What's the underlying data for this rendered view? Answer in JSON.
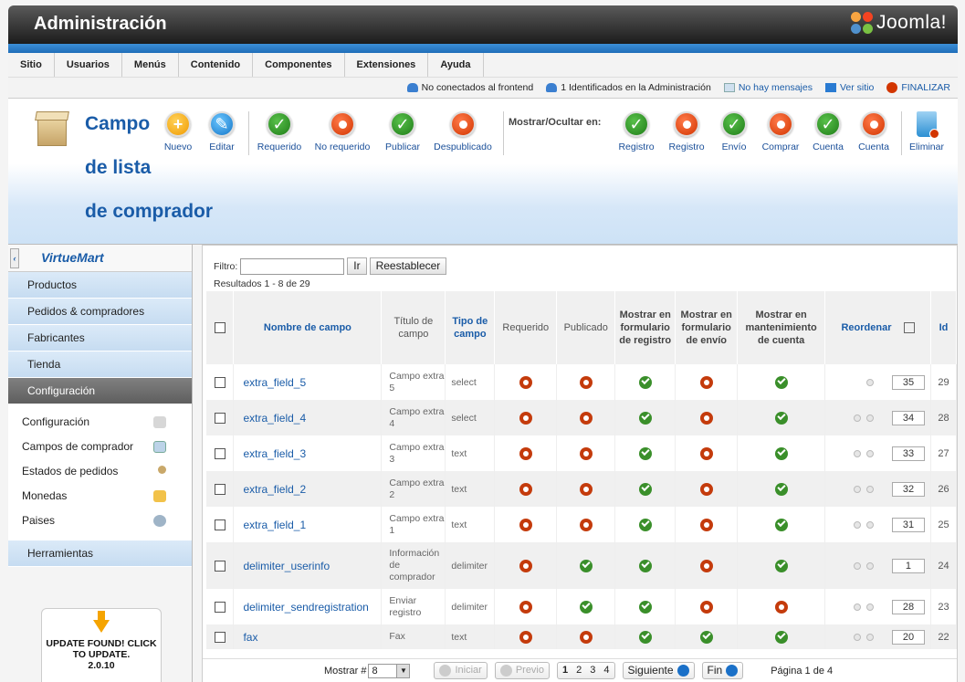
{
  "header": {
    "title": "Administración",
    "brand": "Joomla!"
  },
  "menu": [
    "Sitio",
    "Usuarios",
    "Menús",
    "Contenido",
    "Componentes",
    "Extensiones",
    "Ayuda"
  ],
  "status": {
    "frontend": "No conectados al frontend",
    "admin": "1 Identificados en la Administración",
    "messages": "No hay mensajes",
    "site": "Ver sitio",
    "logout": "FINALIZAR"
  },
  "page": {
    "title_l1": "Campo",
    "title_l2": "de lista",
    "title_l3": "de comprador"
  },
  "toolbar": {
    "nuevo": "Nuevo",
    "editar": "Editar",
    "requerido": "Requerido",
    "no_requerido": "No requerido",
    "publicar": "Publicar",
    "despublicado": "Despublicado",
    "mostrar_ocultar": "Mostrar/Ocultar en:",
    "registro_on": "Registro",
    "registro_off": "Registro",
    "envio": "Envío",
    "comprar": "Comprar",
    "cuenta_on": "Cuenta",
    "cuenta_off": "Cuenta",
    "eliminar": "Eliminar"
  },
  "sidebar": {
    "logo": "VirtueMart",
    "items": [
      "Productos",
      "Pedidos & compradores",
      "Fabricantes",
      "Tienda",
      "Configuración"
    ],
    "sub": [
      "Configuración",
      "Campos de comprador",
      "Estados de pedidos",
      "Monedas",
      "Paises"
    ],
    "tools": "Herramientas",
    "update_l1": "UPDATE FOUND! CLICK",
    "update_l2": "TO UPDATE.",
    "update_ver": "2.0.10"
  },
  "filter": {
    "label": "Filtro:",
    "value": "",
    "go": "Ir",
    "reset": "Reestablecer",
    "results": "Resultados 1 - 8 de 29"
  },
  "columns": {
    "name": "Nombre de campo",
    "title": "Título de campo",
    "type": "Tipo de campo",
    "required": "Requerido",
    "published": "Publicado",
    "reg": "Mostrar en formulario de registro",
    "ship": "Mostrar en formulario de envío",
    "acct": "Mostrar en mantenimiento de cuenta",
    "order": "Reordenar",
    "id": "Id"
  },
  "rows": [
    {
      "name": "extra_field_5",
      "title": "Campo extra 5",
      "type": "select",
      "req": false,
      "pub": false,
      "reg": true,
      "ship": false,
      "acct": true,
      "order": "35",
      "id": "29"
    },
    {
      "name": "extra_field_4",
      "title": "Campo extra 4",
      "type": "select",
      "req": false,
      "pub": false,
      "reg": true,
      "ship": false,
      "acct": true,
      "order": "34",
      "id": "28"
    },
    {
      "name": "extra_field_3",
      "title": "Campo extra 3",
      "type": "text",
      "req": false,
      "pub": false,
      "reg": true,
      "ship": false,
      "acct": true,
      "order": "33",
      "id": "27"
    },
    {
      "name": "extra_field_2",
      "title": "Campo extra 2",
      "type": "text",
      "req": false,
      "pub": false,
      "reg": true,
      "ship": false,
      "acct": true,
      "order": "32",
      "id": "26"
    },
    {
      "name": "extra_field_1",
      "title": "Campo extra 1",
      "type": "text",
      "req": false,
      "pub": false,
      "reg": true,
      "ship": false,
      "acct": true,
      "order": "31",
      "id": "25"
    },
    {
      "name": "delimiter_userinfo",
      "title": "Información de comprador",
      "type": "delimiter",
      "req": false,
      "pub": true,
      "reg": true,
      "ship": false,
      "acct": true,
      "order": "1",
      "id": "24"
    },
    {
      "name": "delimiter_sendregistration",
      "title": "Enviar registro",
      "type": "delimiter",
      "req": false,
      "pub": true,
      "reg": true,
      "ship": false,
      "acct": false,
      "order": "28",
      "id": "23"
    },
    {
      "name": "fax",
      "title": "Fax",
      "type": "text",
      "req": false,
      "pub": false,
      "reg": true,
      "ship": true,
      "acct": true,
      "order": "20",
      "id": "22"
    }
  ],
  "pager": {
    "show": "Mostrar #",
    "limit": "8",
    "first": "Iniciar",
    "prev": "Previo",
    "pages": [
      "1",
      "2",
      "3",
      "4"
    ],
    "next": "Siguiente",
    "last": "Fin",
    "info": "Página 1 de 4"
  }
}
